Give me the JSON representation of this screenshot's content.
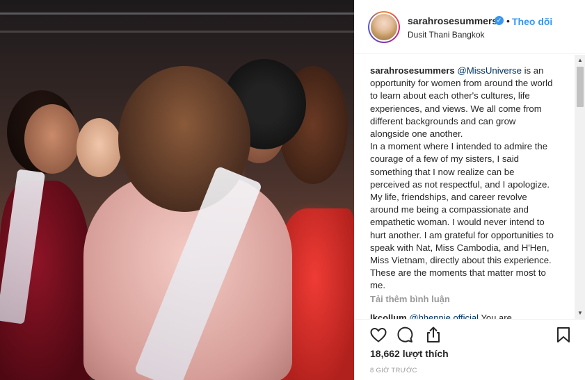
{
  "post": {
    "image_alt": "Photo of contestants hugging"
  },
  "header": {
    "username": "sarahrosesummers",
    "verified_mark": "✓",
    "separator": "•",
    "follow_label": "Theo dõi",
    "location": "Dusit Thani Bangkok"
  },
  "caption": {
    "username": "sarahrosesummers",
    "mention": "@MissUniverse",
    "text_part1": " is an opportunity for women from around the world to learn about each other's cultures, life experiences, and views. We all come from different backgrounds and can grow alongside one another.",
    "text_part2": "In a moment where I intended to admire the courage of a few of my sisters, I said something that I now realize can be perceived as not respectful, and I apologize. My life, friendships, and career revolve around me being a compassionate and empathetic woman. I would never intend to hurt another. I am grateful for opportunities to speak with Nat, Miss Cambodia, and H'Hen, Miss Vietnam, directly about this experience. These are the moments that matter most to me."
  },
  "comments": {
    "load_more": "Tải thêm bình luận",
    "partial_user": "lkcollum",
    "partial_mention": "@hhennie.official",
    "partial_text": " You are"
  },
  "actions": {
    "likes": "18,662 lượt thích",
    "time": "8 GIỜ TRƯỚC"
  },
  "icons": [
    "heart-icon",
    "comment-icon",
    "share-icon",
    "bookmark-icon",
    "verified-badge-icon"
  ],
  "colors": {
    "link_blue": "#3897f0",
    "mention_blue": "#003569",
    "text": "#262626",
    "muted": "#999999",
    "border": "#efefef"
  }
}
